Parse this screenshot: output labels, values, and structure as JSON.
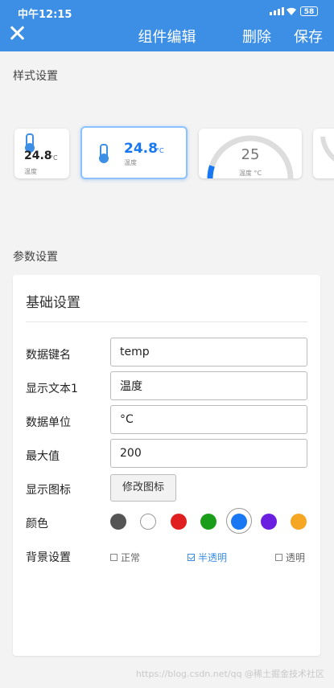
{
  "status_bar": {
    "time": "中午12:15",
    "battery": "58"
  },
  "header": {
    "title": "组件编辑",
    "delete_label": "删除",
    "save_label": "保存"
  },
  "sections": {
    "style": "样式设置",
    "params": "参数设置"
  },
  "style_cards": [
    {
      "value": "24.8",
      "unit": "°C",
      "label": "温度"
    },
    {
      "value": "24.8",
      "unit": "°C",
      "label": "温度"
    },
    {
      "value": "25",
      "label": "温度 °C"
    }
  ],
  "panel": {
    "title": "基础设置",
    "fields": [
      {
        "label": "数据键名",
        "value": "temp"
      },
      {
        "label": "显示文本1",
        "value": "温度"
      },
      {
        "label": "数据单位",
        "value": "°C"
      },
      {
        "label": "最大值",
        "value": "200"
      }
    ],
    "icon_label": "显示图标",
    "icon_button": "修改图标",
    "color_label": "颜色",
    "colors": [
      "#555555",
      "#ffffff",
      "#e02020",
      "#1a9e1a",
      "#1877f2",
      "#6a1fe0",
      "#f5a623"
    ],
    "selected_color": "#1877f2",
    "bg_label": "背景设置",
    "bg_options": [
      {
        "label": "正常",
        "checked": false
      },
      {
        "label": "半透明",
        "checked": true
      },
      {
        "label": "透明",
        "checked": false
      }
    ]
  },
  "watermark": "https://blog.csdn.net/qq @稀土掘金技术社区"
}
